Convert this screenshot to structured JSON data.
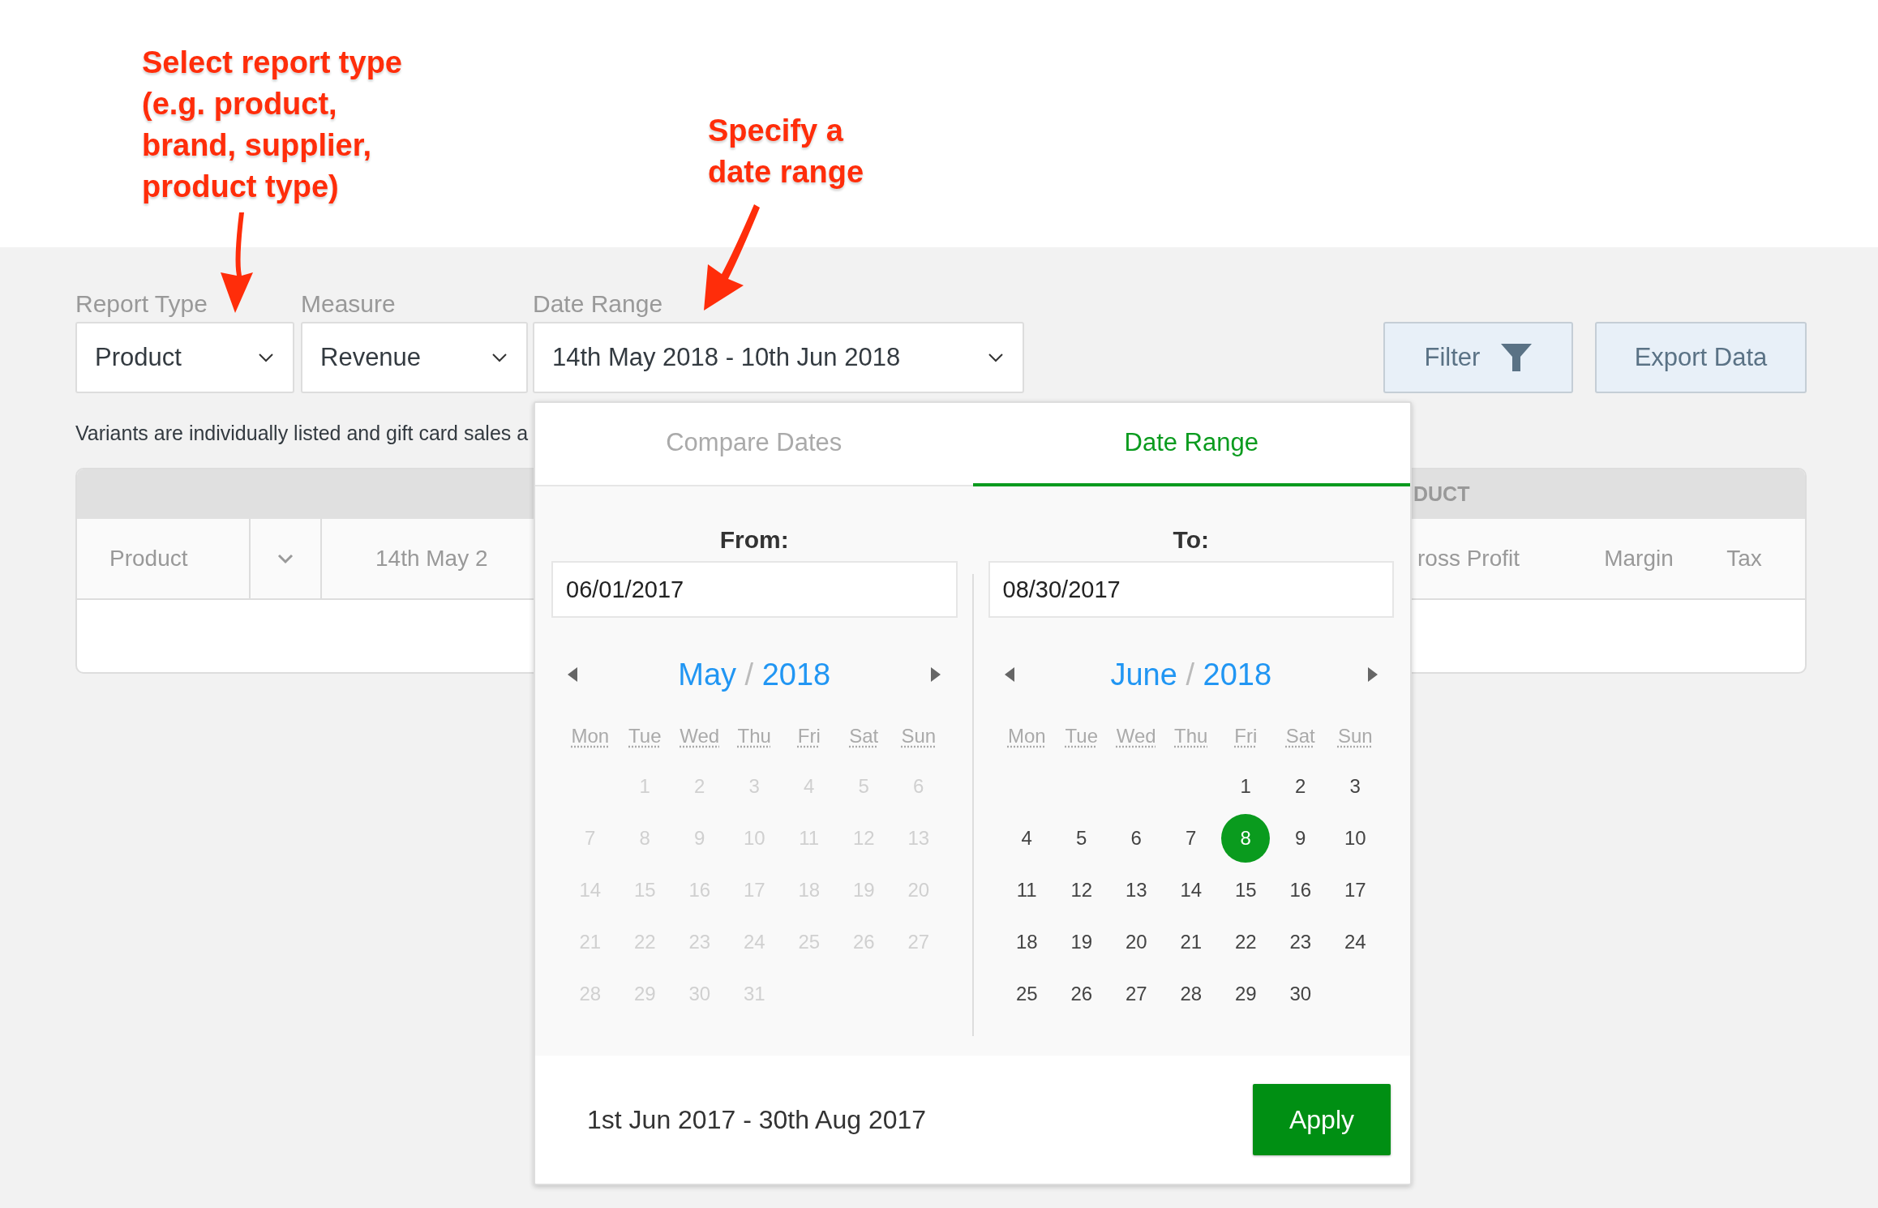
{
  "annotations": [
    {
      "lines": [
        "Select report type",
        "(e.g. product,",
        "brand, supplier,",
        "product type)"
      ]
    },
    {
      "lines": [
        "Specify a",
        "date range"
      ]
    }
  ],
  "controls": [
    {
      "label": "Report Type",
      "value": "Product"
    },
    {
      "label": "Measure",
      "value": "Revenue"
    },
    {
      "label": "Date Range",
      "value": "14th May 2018 - 10th Jun 2018"
    }
  ],
  "buttons": [
    {
      "kind": "filter",
      "label": "Filter"
    },
    {
      "kind": "plain",
      "label": "Export Data"
    }
  ],
  "note": "Variants are individually listed and gift card sales a",
  "table": {
    "group_header": "DUCT",
    "left_columns": [
      "Product",
      "14th May 2"
    ],
    "right_columns": [
      "ross Profit",
      "Margin",
      "Tax"
    ]
  },
  "popover": {
    "tabs": [
      {
        "label": "Compare Dates",
        "selected": false
      },
      {
        "label": "Date Range",
        "selected": true
      }
    ],
    "ranges": [
      {
        "label": "From:",
        "value": "06/01/2017"
      },
      {
        "label": "To:",
        "value": "08/30/2017"
      }
    ],
    "calendars": [
      {
        "month": "May",
        "separator": "/",
        "year": "2018",
        "disabled": true,
        "weekdays": [
          "Mon",
          "Tue",
          "Wed",
          "Thu",
          "Fri",
          "Sat",
          "Sun"
        ],
        "weeks": [
          {
            "kind": "first",
            "days": [
              {
                "day": "1",
                "selected": false
              },
              {
                "day": "2",
                "selected": false
              },
              {
                "day": "3",
                "selected": false
              },
              {
                "day": "4",
                "selected": false
              },
              {
                "day": "5",
                "selected": false
              },
              {
                "day": "6",
                "selected": false
              }
            ]
          },
          {
            "kind": "week",
            "days": [
              {
                "day": "7",
                "selected": false
              },
              {
                "day": "8",
                "selected": false
              },
              {
                "day": "9",
                "selected": false
              },
              {
                "day": "10",
                "selected": false
              },
              {
                "day": "11",
                "selected": false
              },
              {
                "day": "12",
                "selected": false
              },
              {
                "day": "13",
                "selected": false
              }
            ]
          },
          {
            "kind": "week",
            "days": [
              {
                "day": "14",
                "selected": false
              },
              {
                "day": "15",
                "selected": false
              },
              {
                "day": "16",
                "selected": false
              },
              {
                "day": "17",
                "selected": false
              },
              {
                "day": "18",
                "selected": false
              },
              {
                "day": "19",
                "selected": false
              },
              {
                "day": "20",
                "selected": false
              }
            ]
          },
          {
            "kind": "week",
            "days": [
              {
                "day": "21",
                "selected": false
              },
              {
                "day": "22",
                "selected": false
              },
              {
                "day": "23",
                "selected": false
              },
              {
                "day": "24",
                "selected": false
              },
              {
                "day": "25",
                "selected": false
              },
              {
                "day": "26",
                "selected": false
              },
              {
                "day": "27",
                "selected": false
              }
            ]
          },
          {
            "kind": "week",
            "days": [
              {
                "day": "28",
                "selected": false
              },
              {
                "day": "29",
                "selected": false
              },
              {
                "day": "30",
                "selected": false
              },
              {
                "day": "31",
                "selected": false
              }
            ]
          }
        ]
      },
      {
        "month": "June",
        "separator": "/",
        "year": "2018",
        "disabled": false,
        "weekdays": [
          "Mon",
          "Tue",
          "Wed",
          "Thu",
          "Fri",
          "Sat",
          "Sun"
        ],
        "weeks": [
          {
            "kind": "first",
            "days": [
              {
                "day": "1",
                "selected": false
              },
              {
                "day": "2",
                "selected": false
              },
              {
                "day": "3",
                "selected": false
              }
            ]
          },
          {
            "kind": "week",
            "days": [
              {
                "day": "4",
                "selected": false
              },
              {
                "day": "5",
                "selected": false
              },
              {
                "day": "6",
                "selected": false
              },
              {
                "day": "7",
                "selected": false
              },
              {
                "day": "8",
                "selected": true
              },
              {
                "day": "9",
                "selected": false
              },
              {
                "day": "10",
                "selected": false
              }
            ]
          },
          {
            "kind": "week",
            "days": [
              {
                "day": "11",
                "selected": false
              },
              {
                "day": "12",
                "selected": false
              },
              {
                "day": "13",
                "selected": false
              },
              {
                "day": "14",
                "selected": false
              },
              {
                "day": "15",
                "selected": false
              },
              {
                "day": "16",
                "selected": false
              },
              {
                "day": "17",
                "selected": false
              }
            ]
          },
          {
            "kind": "week",
            "days": [
              {
                "day": "18",
                "selected": false
              },
              {
                "day": "19",
                "selected": false
              },
              {
                "day": "20",
                "selected": false
              },
              {
                "day": "21",
                "selected": false
              },
              {
                "day": "22",
                "selected": false
              },
              {
                "day": "23",
                "selected": false
              },
              {
                "day": "24",
                "selected": false
              }
            ]
          },
          {
            "kind": "week",
            "days": [
              {
                "day": "25",
                "selected": false
              },
              {
                "day": "26",
                "selected": false
              },
              {
                "day": "27",
                "selected": false
              },
              {
                "day": "28",
                "selected": false
              },
              {
                "day": "29",
                "selected": false
              },
              {
                "day": "30",
                "selected": false
              }
            ]
          }
        ]
      }
    ],
    "summary": "1st Jun 2017 - 30th Aug 2017",
    "apply": "Apply"
  }
}
